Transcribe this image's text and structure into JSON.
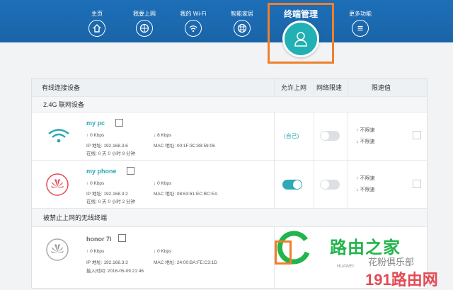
{
  "nav": {
    "items": [
      {
        "label": "主页",
        "icon": "home-icon"
      },
      {
        "label": "我要上网",
        "icon": "globe-icon"
      },
      {
        "label": "我的 Wi-Fi",
        "icon": "wifi-icon"
      },
      {
        "label": "智能家居",
        "icon": "smart-home-icon"
      },
      {
        "label": "更多功能",
        "icon": "menu-icon"
      }
    ],
    "active": {
      "label": "终端管理",
      "icon": "user-icon"
    }
  },
  "table": {
    "header": {
      "title": "有线连接设备",
      "col_internet": "允许上网",
      "col_limit": "网络限速",
      "col_value": "限速值"
    },
    "section1": "2.4G 联网设备",
    "devices": [
      {
        "name": "my pc",
        "up": "0 Kbps",
        "down": "8 Kbps",
        "ip": "IP 地址: 192.168.3.6",
        "mac": "MAC 地址: 00:1F:3C:88:59:06",
        "online": "在线: 0 天 0 小时 9 分钟",
        "internet": "(自己)",
        "limit_up": "不限速",
        "limit_down": "不限速"
      },
      {
        "name": "my phone",
        "up": "0 Kbps",
        "down": "0 Kbps",
        "ip": "IP 地址: 192.168.3.2",
        "mac": "MAC 地址: 08:63:61:EC:BC:EA",
        "online": "在线: 0 天 0 小时 2 分钟",
        "limit_up": "不限速",
        "limit_down": "不限速"
      }
    ],
    "section2": "被禁止上网的无线终端",
    "blocked": {
      "name": "honor 7i",
      "up": "0 Kbps",
      "down": "0 Kbps",
      "ip": "IP 地址: 192.168.3.3",
      "mac": "MAC 地址: 24:00:BA:FE:C3:1D",
      "joined": "接入时间: 2016-05-09 21:46"
    }
  },
  "watermark": {
    "brand": "路由之家",
    "club": "花粉俱乐部",
    "huawei": "HUAWEI",
    "site": "191路由网"
  },
  "colors": {
    "nav": "#1a64a8",
    "accent": "#21b0b4",
    "highlight": "#f07f2c"
  }
}
